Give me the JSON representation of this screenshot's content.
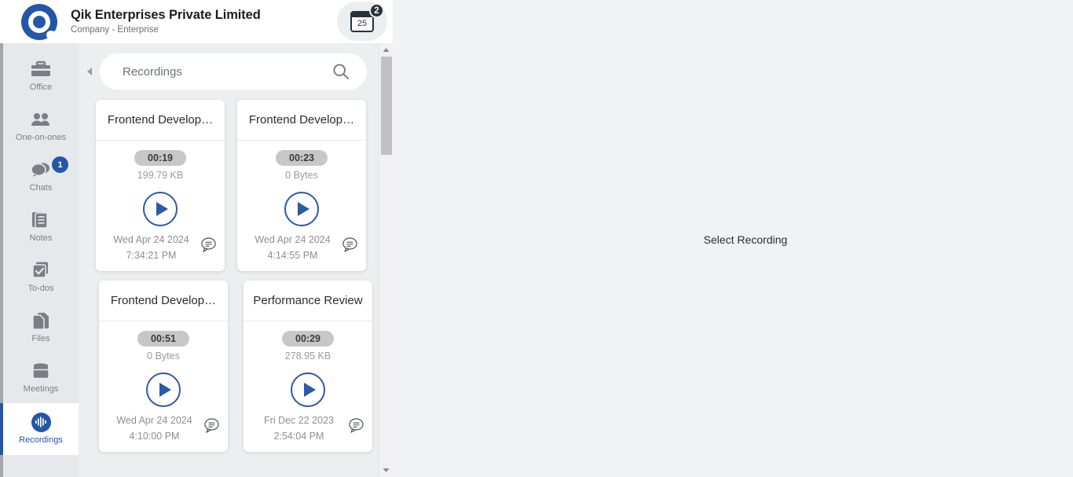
{
  "header": {
    "logo_icon": "qik-logo-icon",
    "company_name": "Qik Enterprises Private Limited",
    "company_subtitle": "Company - Enterprise",
    "calendar": {
      "icon": "calendar-icon",
      "day": "25",
      "badge_count": "2"
    }
  },
  "sidebar": {
    "items": [
      {
        "label": "Office",
        "icon": "briefcase-icon",
        "active": false,
        "badge": null
      },
      {
        "label": "One-on-ones",
        "icon": "people-icon",
        "active": false,
        "badge": null
      },
      {
        "label": "Chats",
        "icon": "chat-bubbles-icon",
        "active": false,
        "badge": "1"
      },
      {
        "label": "Notes",
        "icon": "notes-icon",
        "active": false,
        "badge": null
      },
      {
        "label": "To-dos",
        "icon": "checkbox-stack-icon",
        "active": false,
        "badge": null
      },
      {
        "label": "Files",
        "icon": "files-icon",
        "active": false,
        "badge": null
      },
      {
        "label": "Meetings",
        "icon": "meetings-icon",
        "active": false,
        "badge": null
      },
      {
        "label": "Recordings",
        "icon": "waveform-icon",
        "active": true,
        "badge": null
      }
    ]
  },
  "list_panel": {
    "collapse_icon": "collapse-left-arrow-icon",
    "search": {
      "placeholder": "Recordings",
      "value": "",
      "icon": "search-icon"
    },
    "scrollbar": {
      "up_icon": "scroll-up-arrow-icon",
      "down_icon": "scroll-down-arrow-icon"
    },
    "cards": [
      {
        "title": "Frontend Develop…",
        "duration": "00:19",
        "size": "199.79 KB",
        "date": "Wed Apr 24 2024",
        "time": "7:34:21 PM",
        "play_icon": "play-icon",
        "comment_icon": "comment-icon"
      },
      {
        "title": "Frontend Develop…",
        "duration": "00:23",
        "size": "0 Bytes",
        "date": "Wed Apr 24 2024",
        "time": "4:14:55 PM",
        "play_icon": "play-icon",
        "comment_icon": "comment-icon"
      },
      {
        "title": "Frontend Develop…",
        "duration": "00:51",
        "size": "0 Bytes",
        "date": "Wed Apr 24 2024",
        "time": "4:10:00 PM",
        "play_icon": "play-icon",
        "comment_icon": "comment-icon"
      },
      {
        "title": "Performance Review",
        "duration": "00:29",
        "size": "278.95 KB",
        "date": "Fri Dec 22 2023",
        "time": "2:54:04 PM",
        "play_icon": "play-icon",
        "comment_icon": "comment-icon"
      }
    ]
  },
  "detail": {
    "placeholder": "Select Recording"
  },
  "colors": {
    "brand_blue": "#2457a8",
    "play_blue": "#2d59a6",
    "sidebar_bg": "#e6e8eb",
    "panel_bg": "#eceef0",
    "detail_bg": "#f1f2f4",
    "badge_dark": "#2b3138"
  }
}
